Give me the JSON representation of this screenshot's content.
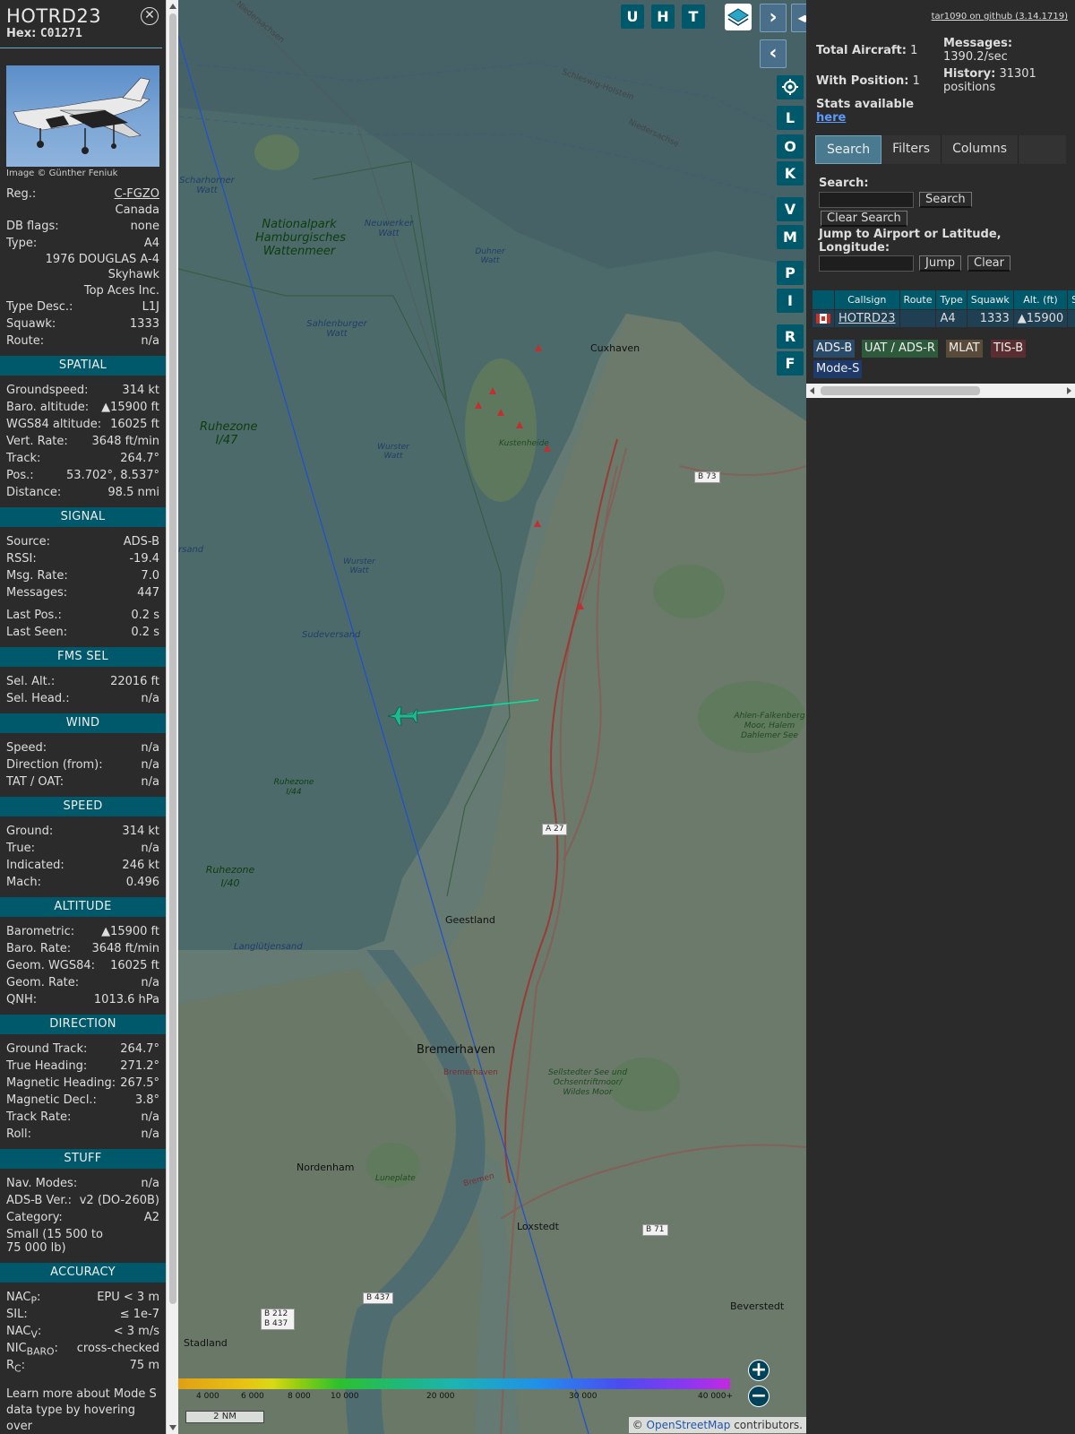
{
  "aircraft": {
    "callsign": "HOTRD23",
    "hex_label": "Hex:",
    "hex": "C01271",
    "image_credit": "Image © Günther Feniuk",
    "reg_label": "Reg.:",
    "reg": "C-FGZO",
    "country": "Canada",
    "dbflags_label": "DB flags:",
    "dbflags": "none",
    "type_label": "Type:",
    "type": "A4",
    "type_full_1": "1976 DOUGLAS A-4",
    "type_full_2": "Skyhawk",
    "operator": "Top Aces Inc.",
    "typedesc_label": "Type Desc.:",
    "typedesc": "L1J",
    "squawk_label": "Squawk:",
    "squawk": "1333",
    "route_label": "Route:",
    "route": "n/a"
  },
  "sections": {
    "spatial": "SPATIAL",
    "signal": "SIGNAL",
    "fms": "FMS SEL",
    "wind": "WIND",
    "speed": "SPEED",
    "altitude": "ALTITUDE",
    "direction": "DIRECTION",
    "stuff": "STUFF",
    "accuracy": "ACCURACY"
  },
  "spatial": [
    {
      "label": "Groundspeed:",
      "value": "314 kt"
    },
    {
      "label": "Baro. altitude:",
      "value": "▲15900 ft"
    },
    {
      "label": "WGS84 altitude:",
      "value": "16025 ft"
    },
    {
      "label": "Vert. Rate:",
      "value": "3648 ft/min"
    },
    {
      "label": "Track:",
      "value": "264.7°"
    },
    {
      "label": "Pos.:",
      "value": "53.702°, 8.537°"
    },
    {
      "label": "Distance:",
      "value": "98.5 nmi"
    }
  ],
  "signal": [
    {
      "label": "Source:",
      "value": "ADS-B"
    },
    {
      "label": "RSSI:",
      "value": "-19.4"
    },
    {
      "label": "Msg. Rate:",
      "value": "7.0"
    },
    {
      "label": "Messages:",
      "value": "447"
    }
  ],
  "signal2": [
    {
      "label": "Last Pos.:",
      "value": "0.2 s"
    },
    {
      "label": "Last Seen:",
      "value": "0.2 s"
    }
  ],
  "fms": [
    {
      "label": "Sel. Alt.:",
      "value": "22016 ft"
    },
    {
      "label": "Sel. Head.:",
      "value": "n/a"
    }
  ],
  "wind": [
    {
      "label": "Speed:",
      "value": "n/a"
    },
    {
      "label": "Direction (from):",
      "value": "n/a"
    },
    {
      "label": "TAT / OAT:",
      "value": "n/a"
    }
  ],
  "speed": [
    {
      "label": "Ground:",
      "value": "314 kt"
    },
    {
      "label": "True:",
      "value": "n/a"
    },
    {
      "label": "Indicated:",
      "value": "246 kt"
    },
    {
      "label": "Mach:",
      "value": "0.496"
    }
  ],
  "altitude": [
    {
      "label": "Barometric:",
      "value": "▲15900 ft"
    },
    {
      "label": "Baro. Rate:",
      "value": "3648 ft/min"
    },
    {
      "label": "Geom. WGS84:",
      "value": "16025 ft"
    },
    {
      "label": "Geom. Rate:",
      "value": "n/a"
    },
    {
      "label": "QNH:",
      "value": "1013.6 hPa"
    }
  ],
  "direction": [
    {
      "label": "Ground Track:",
      "value": "264.7°"
    },
    {
      "label": "True Heading:",
      "value": "271.2°"
    },
    {
      "label": "Magnetic Heading:",
      "value": "267.5°"
    },
    {
      "label": "Magnetic Decl.:",
      "value": "3.8°"
    },
    {
      "label": "Track Rate:",
      "value": "n/a"
    },
    {
      "label": "Roll:",
      "value": "n/a"
    }
  ],
  "stuff": {
    "nav_label": "Nav. Modes:",
    "nav": "n/a",
    "adsb_label": "ADS-B Ver.:",
    "adsb": "v2 (DO-260B)",
    "cat_label": "Category:",
    "cat": "A2",
    "cat_desc": "Small (15 500 to 75 000 lb)"
  },
  "accuracy": {
    "nacp_label": "NAC",
    "nacp_sub": "P",
    "nacp": "EPU < 3 m",
    "sil_label": "SIL:",
    "sil": "≤ 1e-7",
    "nacv_label": "NAC",
    "nacv_sub": "V",
    "nacv": "< 3 m/s",
    "nicbaro_label": "NIC",
    "nicbaro_sub": "BARO",
    "nicbaro": "cross-checked",
    "rc_label": "R",
    "rc_sub": "C",
    "rc": "75 m",
    "footer": "Learn more about Mode S data type by hovering over"
  },
  "map_buttons": {
    "u": "U",
    "h": "H",
    "t": "T",
    "l": "L",
    "o": "O",
    "k": "K",
    "v": "V",
    "m": "M",
    "p": "P",
    "i": "I",
    "r": "R",
    "f": "F",
    "next": "›",
    "prev": "‹",
    "expand": "◂▸",
    "zoom_in": "+",
    "zoom_out": "−"
  },
  "map_labels": {
    "cuxhaven": "Cuxhaven",
    "kustenheide": "Kustenheide",
    "geestland": "Geestland",
    "bremerhaven": "Bremerhaven",
    "bremerhaven_small": "Bremerhaven",
    "nordenham": "Nordenham",
    "loxstedt": "Loxstedt",
    "stadland": "Stadland",
    "beverstedt": "Beverstedt",
    "luneplate": "Luneplate",
    "sellstedter": "Sellstedter See und Ochsentriftmoor/ Wildes Moor",
    "nationalpark": "Nationalpark Hamburgisches Wattenmeer",
    "ruhezone147": "Ruhezone I/47",
    "ruhezone140": "Ruhezone I/40",
    "ruhezone144": "Ruhezone I/44",
    "neuwerker": "Neuwerker Watt",
    "duhner": "Duhner Watt",
    "sahlenburger": "Sahlenburger Watt",
    "wurster1": "Wurster Watt",
    "wurster2": "Wurster Watt",
    "scharhorner": "Scharhorner Watt",
    "sudeversand": "Sudeversand",
    "langlutjensand": "Langlütjensand",
    "rsand": "rsand",
    "schleswig": "Schleswig-Holstein",
    "niedersachsen": "Niedersachsen",
    "niedersachse2": "Niedersachse",
    "ahlen": "Ahlen-Falkenberg Moor, Halem Dahlemer See",
    "a27": "A 27",
    "b73": "B 73",
    "b71": "B 71",
    "b437": "B 437",
    "b212": "B 212 B 437",
    "bremen": "Bremen"
  },
  "altitude_scale": {
    "l1": "4 000",
    "l2": "6 000",
    "l3": "8 000",
    "l4": "10 000",
    "l5": "20 000",
    "l6": "30 000",
    "l7": "40 000+"
  },
  "scale_bar": "2 NM",
  "attribution": {
    "prefix": "© ",
    "link": "OpenStreetMap",
    "suffix": " contributors."
  },
  "right": {
    "github": "tar1090 on github (3.14.1719)",
    "total_label": "Total Aircraft:",
    "total": "1",
    "pos_label": "With Position:",
    "pos": "1",
    "msgs_label": "Messages:",
    "msgs": "1390.2/sec",
    "hist_label": "History:",
    "hist": "31301 positions",
    "stats_label": "Stats available",
    "stats_link": "here",
    "tabs": [
      "Search",
      "Filters",
      "Columns"
    ],
    "search_label": "Search:",
    "search_btn": "Search",
    "clear_search_btn": "Clear Search",
    "jump_label": "Jump to Airport or Latitude, Longitude:",
    "jump_btn": "Jump",
    "clear_btn": "Clear",
    "columns": [
      "Callsign",
      "Route",
      "Type",
      "Squawk",
      "Alt. (ft)",
      "Sp"
    ],
    "row": {
      "callsign": "HOTRD23",
      "route": "",
      "type": "A4",
      "squawk": "1333",
      "alt": "▲15900"
    },
    "chips": [
      "ADS-B",
      "UAT / ADS-R",
      "MLAT",
      "TIS-B",
      "Mode-S"
    ]
  },
  "colors": {
    "panel": "#2b2b2b",
    "section": "#00596b",
    "map_button": "#00596b",
    "track": "#00e6a0"
  }
}
